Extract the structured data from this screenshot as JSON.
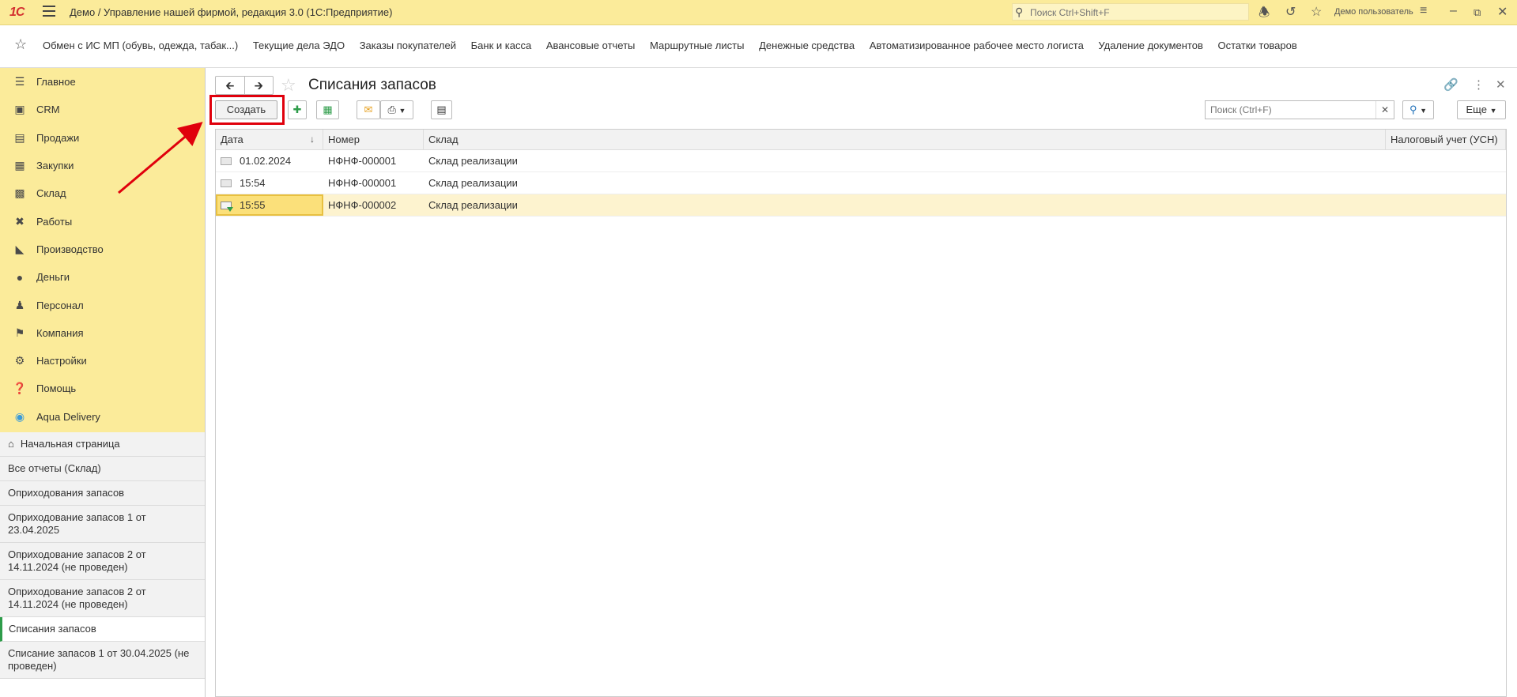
{
  "titlebar": {
    "logo": "1С",
    "title": "Демо / Управление нашей фирмой, редакция 3.0  (1С:Предприятие)",
    "search_placeholder": "Поиск Ctrl+Shift+F",
    "user": "Демо пользователь"
  },
  "sections_bar": {
    "links": [
      "Обмен с ИС МП (обувь, одежда, табак...)",
      "Текущие дела ЭДО",
      "Заказы покупателей",
      "Банк и касса",
      "Авансовые отчеты",
      "Маршрутные листы",
      "Денежные средства",
      "Автоматизированное рабочее место логиста",
      "Удаление документов",
      "Остатки товаров"
    ]
  },
  "sidebar": {
    "nav": [
      {
        "label": "Главное",
        "icon": "list-icon"
      },
      {
        "label": "CRM",
        "icon": "crm-icon"
      },
      {
        "label": "Продажи",
        "icon": "basket-icon"
      },
      {
        "label": "Закупки",
        "icon": "cart-icon"
      },
      {
        "label": "Склад",
        "icon": "warehouse-icon"
      },
      {
        "label": "Работы",
        "icon": "tools-icon"
      },
      {
        "label": "Производство",
        "icon": "factory-icon"
      },
      {
        "label": "Деньги",
        "icon": "money-icon"
      },
      {
        "label": "Персонал",
        "icon": "people-icon"
      },
      {
        "label": "Компания",
        "icon": "flag-icon"
      },
      {
        "label": "Настройки",
        "icon": "gear-icon"
      },
      {
        "label": "Помощь",
        "icon": "help-icon"
      },
      {
        "label": "Aqua Delivery",
        "icon": "location-icon"
      }
    ],
    "open_windows": [
      "Начальная страница",
      "Все отчеты (Склад)",
      "Оприходования запасов",
      "Оприходование запасов 1 от 23.04.2025",
      "Оприходование запасов 2 от 14.11.2024 (не проведен)",
      "Оприходование запасов 2 от 14.11.2024 (не проведен)",
      "Списания запасов",
      "Списание запасов 1 от 30.04.2025 (не проведен)"
    ]
  },
  "form": {
    "title": "Списания запасов",
    "create_label": "Создать",
    "search_placeholder": "Поиск (Ctrl+F)",
    "more_label": "Еще",
    "columns": [
      "Дата",
      "Номер",
      "Склад",
      "Налоговый учет (УСН)"
    ],
    "rows": [
      {
        "date": "01.02.2024",
        "number": "НФНФ-000001",
        "warehouse": "Склад реализации",
        "tax": "",
        "posted": false
      },
      {
        "date": "15:54",
        "number": "НФНФ-000001",
        "warehouse": "Склад реализации",
        "tax": "",
        "posted": false
      },
      {
        "date": "15:55",
        "number": "НФНФ-000002",
        "warehouse": "Склад реализации",
        "tax": "",
        "posted": true
      }
    ]
  },
  "colors": {
    "panel": "#fbeb9a",
    "highlight": "#e0000c",
    "selected_row": "#fdf3cf"
  }
}
